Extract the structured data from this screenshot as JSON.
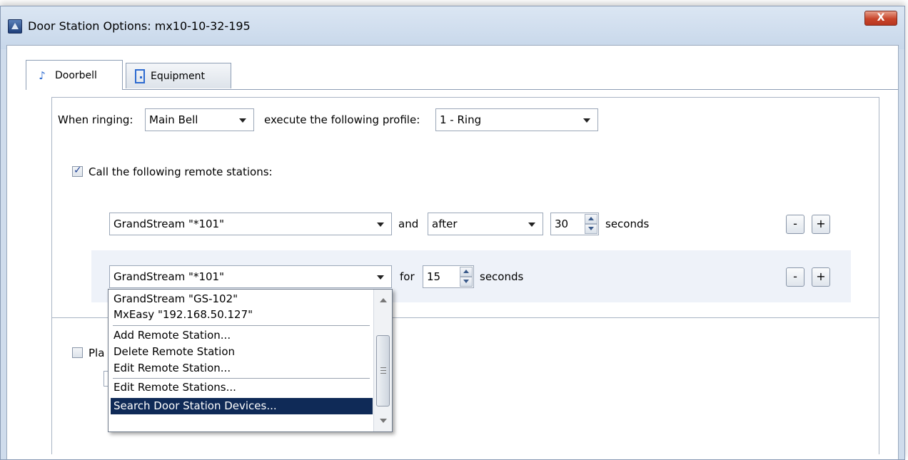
{
  "window": {
    "title": "Door Station Options: mx10-10-32-195",
    "close_label": "X"
  },
  "tabs": [
    {
      "label": "Doorbell",
      "icon": "bell-icon",
      "active": true
    },
    {
      "label": "Equipment",
      "icon": "door-icon",
      "active": false
    }
  ],
  "ringing": {
    "label": "When ringing:",
    "bell_value": "Main Bell",
    "profile_label": "execute the following profile:",
    "profile_value": "1 - Ring"
  },
  "call_remote": {
    "checked": true,
    "label": "Call the following remote stations:"
  },
  "rows": [
    {
      "station": "GrandStream \"*101\"",
      "connector": "and",
      "timing": "after",
      "value": "30",
      "unit": "seconds",
      "minus": "-",
      "plus": "+"
    },
    {
      "station": "GrandStream \"*101\"",
      "connector": "for",
      "value": "15",
      "unit": "seconds",
      "minus": "-",
      "plus": "+"
    }
  ],
  "play": {
    "checked": false,
    "label_partial": "Pla"
  },
  "dropdown": {
    "items": [
      "GrandStream \"GS-102\"",
      "MxEasy \"192.168.50.127\"",
      "Add Remote Station...",
      "Delete Remote Station",
      "Edit Remote Station...",
      "Edit Remote Stations...",
      "Search Door Station Devices..."
    ],
    "selected_index": 6
  },
  "colors": {
    "selection": "#0f2a57",
    "window_frame": "#cfdcec",
    "row_highlight": "#eef2f9"
  }
}
